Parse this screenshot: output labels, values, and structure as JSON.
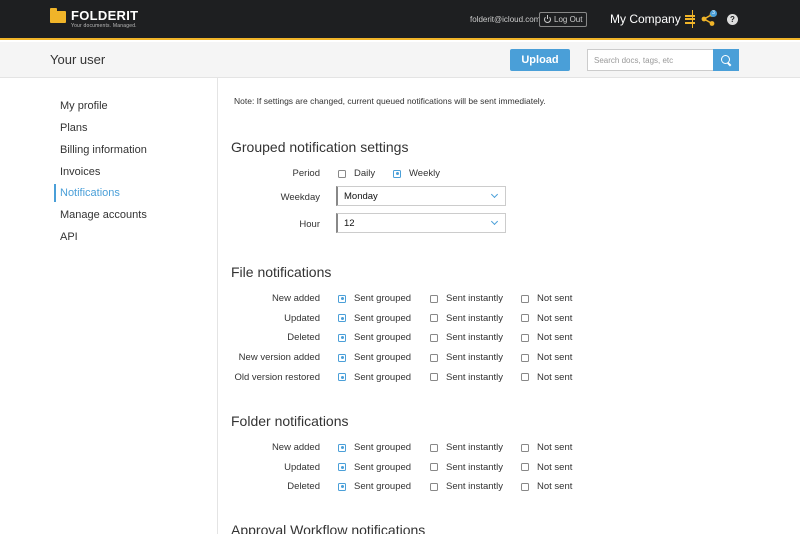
{
  "topbar": {
    "logo_name": "FOLDERIT",
    "logo_tagline": "Your documents. Managed.",
    "user_email": "folderit@icloud.com",
    "logout_label": "Log Out",
    "company_name": "My Company",
    "notification_count": "3",
    "help_label": "?",
    "colors": {
      "background": "#1e1f21",
      "accent": "#f0b429"
    }
  },
  "subheader": {
    "title": "Your user",
    "upload_label": "Upload",
    "search_placeholder": "Search docs, tags, etc",
    "search_value": ""
  },
  "sidebar": {
    "items": [
      {
        "label": "My profile",
        "active": false
      },
      {
        "label": "Plans",
        "active": false
      },
      {
        "label": "Billing information",
        "active": false
      },
      {
        "label": "Invoices",
        "active": false
      },
      {
        "label": "Notifications",
        "active": true
      },
      {
        "label": "Manage accounts",
        "active": false
      },
      {
        "label": "API",
        "active": false
      }
    ]
  },
  "main": {
    "note": "Note: If settings are changed, current queued notifications will be sent immediately.",
    "grouped": {
      "title": "Grouped notification settings",
      "period_label": "Period",
      "period_options": [
        {
          "label": "Daily",
          "checked": false
        },
        {
          "label": "Weekly",
          "checked": true
        }
      ],
      "weekday_label": "Weekday",
      "weekday_value": "Monday",
      "hour_label": "Hour",
      "hour_value": "12"
    },
    "options": [
      "Sent grouped",
      "Sent instantly",
      "Not sent"
    ],
    "file_notifications": {
      "title": "File notifications",
      "rows": [
        {
          "label": "New added",
          "selected": "Sent grouped"
        },
        {
          "label": "Updated",
          "selected": "Sent grouped"
        },
        {
          "label": "Deleted",
          "selected": "Sent grouped"
        },
        {
          "label": "New version added",
          "selected": "Sent grouped"
        },
        {
          "label": "Old version restored",
          "selected": "Sent grouped"
        }
      ]
    },
    "folder_notifications": {
      "title": "Folder notifications",
      "rows": [
        {
          "label": "New added",
          "selected": "Sent grouped"
        },
        {
          "label": "Updated",
          "selected": "Sent grouped"
        },
        {
          "label": "Deleted",
          "selected": "Sent grouped"
        }
      ]
    },
    "approval_title": "Approval Workflow notifications"
  },
  "colors": {
    "link_blue": "#4a9fd8"
  }
}
